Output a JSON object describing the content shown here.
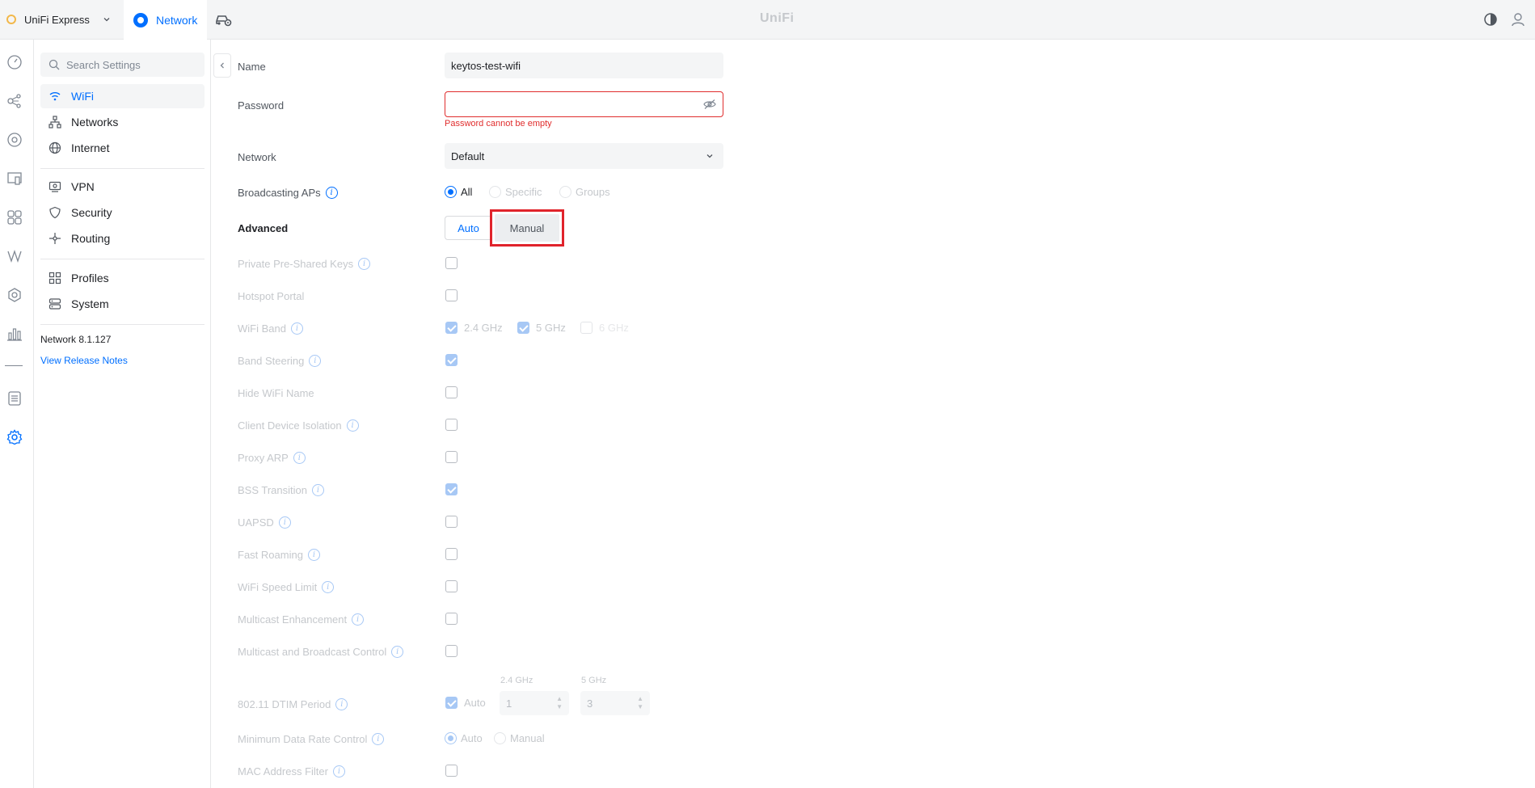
{
  "topbar": {
    "console_name": "UniFi Express",
    "app_tab": "Network",
    "brand": "UniFi"
  },
  "nav": {
    "search_placeholder": "Search Settings",
    "items": [
      {
        "label": "WiFi",
        "icon": "wifi-icon",
        "active": true
      },
      {
        "label": "Networks",
        "icon": "network-topology-icon"
      },
      {
        "label": "Internet",
        "icon": "globe-icon"
      },
      {
        "label": "VPN",
        "icon": "vpn-icon"
      },
      {
        "label": "Security",
        "icon": "shield-icon"
      },
      {
        "label": "Routing",
        "icon": "routing-icon"
      },
      {
        "label": "Profiles",
        "icon": "profiles-icon"
      },
      {
        "label": "System",
        "icon": "system-icon"
      }
    ],
    "version": "Network 8.1.127",
    "release_notes": "View Release Notes"
  },
  "form": {
    "name": {
      "label": "Name",
      "value": "keytos-test-wifi"
    },
    "password": {
      "label": "Password",
      "value": "",
      "error": "Password cannot be empty"
    },
    "network": {
      "label": "Network",
      "value": "Default"
    },
    "broadcasting_aps": {
      "label": "Broadcasting APs",
      "options": [
        "All",
        "Specific",
        "Groups"
      ],
      "selected": "All"
    },
    "advanced": {
      "label": "Advanced",
      "options": [
        "Auto",
        "Manual"
      ],
      "highlighted": "Manual"
    },
    "rows": {
      "ppsk": "Private Pre-Shared Keys",
      "hotspot": "Hotspot Portal",
      "wifi_band": "WiFi Band",
      "band_steering": "Band Steering",
      "hide_name": "Hide WiFi Name",
      "client_isolation": "Client Device Isolation",
      "proxy_arp": "Proxy ARP",
      "bss_transition": "BSS Transition",
      "uapsd": "UAPSD",
      "fast_roaming": "Fast Roaming",
      "speed_limit": "WiFi Speed Limit",
      "multicast_enh": "Multicast Enhancement",
      "multicast_bcast": "Multicast and Broadcast Control",
      "dtim": "802.11 DTIM Period",
      "min_rate": "Minimum Data Rate Control",
      "mac_filter": "MAC Address Filter"
    },
    "bands": [
      "2.4 GHz",
      "5 GHz",
      "6 GHz"
    ],
    "dtim": {
      "auto_label": "Auto",
      "band_24": "2.4 GHz",
      "band_5": "5 GHz",
      "value_24": "1",
      "value_5": "3"
    },
    "min_rate_options": [
      "Auto",
      "Manual"
    ]
  },
  "colors": {
    "accent": "#006fff",
    "error": "#e02d2d",
    "highlight": "#e0232b"
  }
}
